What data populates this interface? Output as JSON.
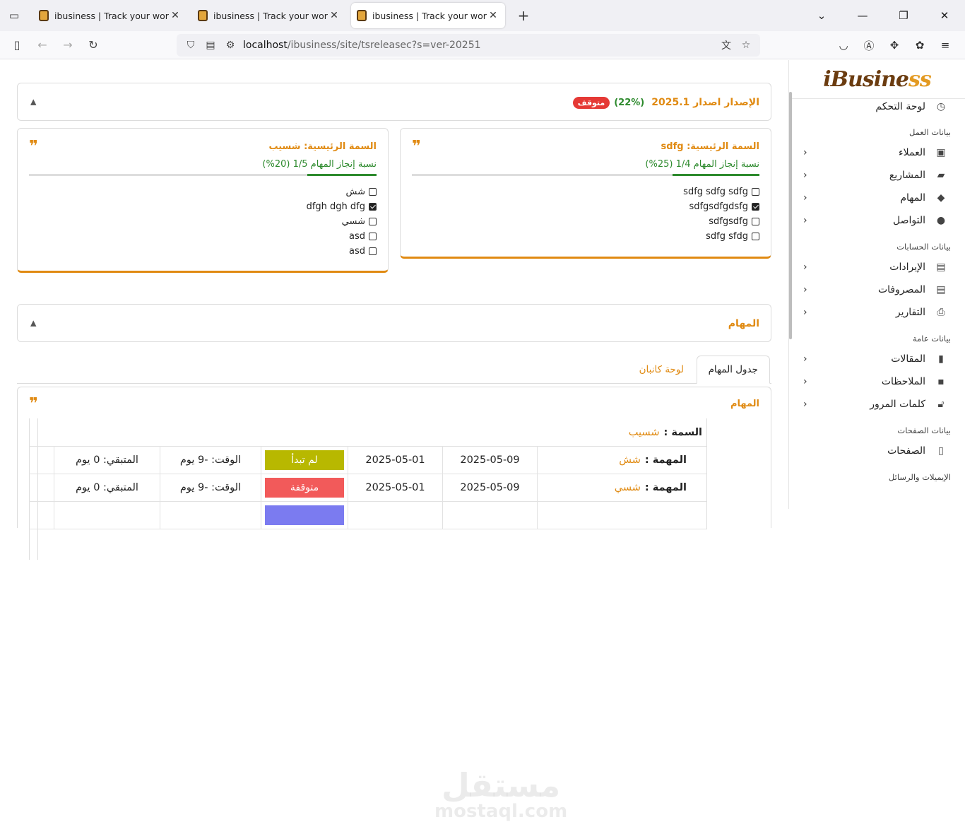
{
  "browser": {
    "tabs": [
      {
        "title": "ibusiness | Track your work with"
      },
      {
        "title": "ibusiness | Track your work with"
      },
      {
        "title": "ibusiness | Track your work with"
      }
    ],
    "url_host": "localhost",
    "url_path": "/ibusiness/site/tsreleasec?s=ver-20251"
  },
  "sidebar": {
    "logo_main": "iBusine",
    "logo_accent": "ss",
    "dashboard": "لوحة التحكم",
    "sections": [
      {
        "title": "بيانات العمل",
        "items": [
          "العملاء",
          "المشاريع",
          "المهام",
          "التواصل"
        ]
      },
      {
        "title": "بيانات الحسابات",
        "items": [
          "الإيرادات",
          "المصروفات",
          "التقارير"
        ]
      },
      {
        "title": "بيانات عامة",
        "items": [
          "المقالات",
          "الملاحظات",
          "كلمات المرور"
        ]
      },
      {
        "title": "بيانات الصفحات",
        "items": [
          "الصفحات"
        ]
      },
      {
        "title": "الإيميلات والرسائل",
        "items": []
      }
    ]
  },
  "release": {
    "title": "الإصدار اصدار 2025.1",
    "percent_label": "(22%)",
    "status": "متوقف"
  },
  "features": [
    {
      "title": "السمة الرئيسية: sdfg",
      "progress_text": "نسبة إنجاز المهام 1/4 (25%)",
      "progress": 0.25,
      "items": [
        {
          "text": "sdfg sdfg sdfg",
          "done": false
        },
        {
          "text": "sdfgsdfgdsfg",
          "done": true
        },
        {
          "text": "sdfgsdfg",
          "done": false
        },
        {
          "text": "sdfg sfdg",
          "done": false
        }
      ]
    },
    {
      "title": "السمة الرئيسية: شسيب",
      "progress_text": "نسبة إنجاز المهام 1/5 (20%)",
      "progress": 0.2,
      "items": [
        {
          "text": "شش",
          "done": false
        },
        {
          "text": "dfgh dgh dfg",
          "done": true
        },
        {
          "text": "شسي",
          "done": false
        },
        {
          "text": "asd",
          "done": false
        },
        {
          "text": "asd",
          "done": false
        }
      ]
    }
  ],
  "tasks_section": {
    "title": "المهام"
  },
  "page_tabs": {
    "table": "جدول المهام",
    "kanban": "لوحة كانبان"
  },
  "task_table": {
    "title": "المهام",
    "feature_label": "السمة :",
    "feature_value": "شسيب",
    "task_label": "المهمة :",
    "rows": [
      {
        "name": "شش",
        "end": "2025-05-09",
        "start": "2025-05-01",
        "status": "لم تبدأ",
        "status_color": "#b8b800",
        "time": "الوقت: -9 يوم",
        "remain": "المتبقي: 0 يوم"
      },
      {
        "name": "شسي",
        "end": "2025-05-09",
        "start": "2025-05-01",
        "status": "متوقفة",
        "status_color": "#f25a5a",
        "time": "الوقت: -9 يوم",
        "remain": "المتبقي: 0 يوم"
      },
      {
        "name": "",
        "end": "",
        "start": "",
        "status": "",
        "status_color": "#7b7bf0",
        "time": "",
        "remain": ""
      }
    ]
  },
  "colors": {
    "accent": "#e08a12",
    "success": "#2d8a2d",
    "danger": "#e53935"
  }
}
